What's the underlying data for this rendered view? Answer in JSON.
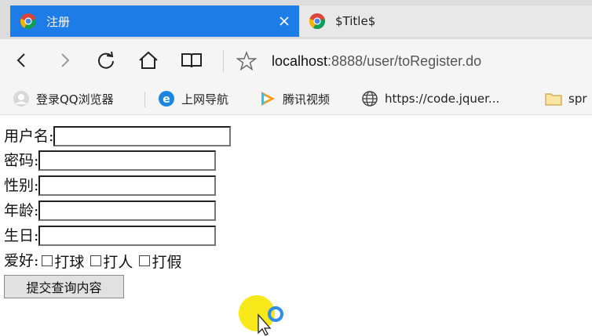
{
  "tabs": [
    {
      "title": "注册",
      "active": true,
      "favicon": "chrome-logo-icon"
    },
    {
      "title": "$Title$",
      "active": false,
      "favicon": "chrome-logo-icon"
    }
  ],
  "address_bar": {
    "url_host": "localhost",
    "url_rest": ":8888/user/toRegister.do"
  },
  "bookmarks": [
    {
      "label": "登录QQ浏览器",
      "icon": "user-avatar-icon"
    },
    {
      "label": "上网导航",
      "icon": "ie-logo-icon"
    },
    {
      "label": "腾讯视频",
      "icon": "tencent-video-icon"
    },
    {
      "label": "https://code.jquer...",
      "icon": "globe-icon"
    },
    {
      "label": "spr",
      "icon": "folder-icon"
    }
  ],
  "form": {
    "username_label": "用户名:",
    "password_label": "密码:",
    "gender_label": "性别:",
    "age_label": "年龄:",
    "birthday_label": "生日:",
    "hobby_label": "爱好:",
    "hobbies": [
      "打球",
      "打人",
      "打假"
    ],
    "submit_label": "提交查询内容"
  },
  "colors": {
    "active_tab": "#1e7ce8",
    "cursor_highlight": "#f5e600",
    "click_ring": "#2f8fe8"
  }
}
